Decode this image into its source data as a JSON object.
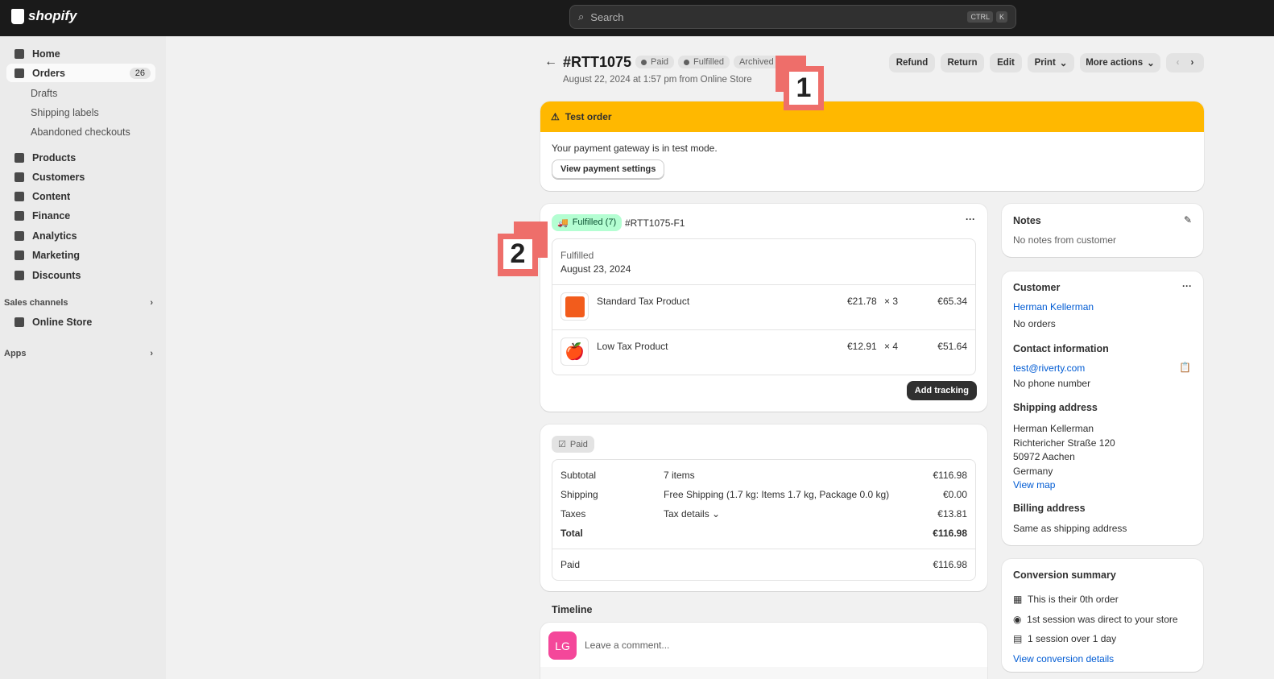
{
  "topbar": {
    "brand": "shopify",
    "search_placeholder": "Search",
    "kbd": [
      "CTRL",
      "K"
    ]
  },
  "sidebar": {
    "items": [
      {
        "label": "Home"
      },
      {
        "label": "Orders",
        "count": "26"
      },
      {
        "label": "Drafts"
      },
      {
        "label": "Shipping labels"
      },
      {
        "label": "Abandoned checkouts"
      },
      {
        "label": "Products"
      },
      {
        "label": "Customers"
      },
      {
        "label": "Content"
      },
      {
        "label": "Finance"
      },
      {
        "label": "Analytics"
      },
      {
        "label": "Marketing"
      },
      {
        "label": "Discounts"
      }
    ],
    "sales_channels": "Sales channels",
    "online_store": "Online Store",
    "apps": "Apps"
  },
  "order": {
    "title": "#RTT1075",
    "badges": [
      "Paid",
      "Fulfilled",
      "Archived"
    ],
    "subtitle": "August 22, 2024 at 1:57 pm from Online Store"
  },
  "actions": {
    "refund": "Refund",
    "return": "Return",
    "edit": "Edit",
    "print": "Print",
    "more": "More actions"
  },
  "banner": {
    "title": "Test order",
    "text": "Your payment gateway is in test mode.",
    "button": "View payment settings",
    "color": "#ffb800"
  },
  "fulfillment": {
    "badge": "Fulfilled (7)",
    "id": "#RTT1075-F1",
    "status": "Fulfilled",
    "date": "August 23, 2024",
    "items": [
      {
        "name": "Standard Tax Product",
        "price": "€21.78",
        "qty": "× 3",
        "total": "€65.34"
      },
      {
        "name": "Low Tax Product",
        "price": "€12.91",
        "qty": "× 4",
        "total": "€51.64"
      }
    ],
    "add_tracking": "Add tracking"
  },
  "payment": {
    "badge": "Paid",
    "rows": [
      {
        "label": "Subtotal",
        "detail": "7 items",
        "amount": "€116.98"
      },
      {
        "label": "Shipping",
        "detail": "Free Shipping (1.7 kg: Items 1.7 kg, Package 0.0 kg)",
        "amount": "€0.00"
      },
      {
        "label": "Taxes",
        "detail": "Tax details",
        "amount": "€13.81"
      },
      {
        "label": "Total",
        "detail": "",
        "amount": "€116.98"
      }
    ],
    "paid_label": "Paid",
    "paid_amount": "€116.98"
  },
  "timeline": {
    "title": "Timeline",
    "avatar": "LG",
    "placeholder": "Leave a comment..."
  },
  "notes": {
    "title": "Notes",
    "text": "No notes from customer"
  },
  "customer": {
    "title": "Customer",
    "name": "Herman Kellerman",
    "orders": "No orders",
    "contact_title": "Contact information",
    "email": "test@riverty.com",
    "phone": "No phone number",
    "shipping_title": "Shipping address",
    "address": [
      "Herman Kellerman",
      "Richtericher Straße 120",
      "50972 Aachen",
      "Germany"
    ],
    "view_map": "View map",
    "billing_title": "Billing address",
    "billing": "Same as shipping address"
  },
  "conversion": {
    "title": "Conversion summary",
    "items": [
      "This is their 0th order",
      "1st session was direct to your store",
      "1 session over 1 day"
    ],
    "link": "View conversion details"
  },
  "markers": [
    "1",
    "2"
  ]
}
